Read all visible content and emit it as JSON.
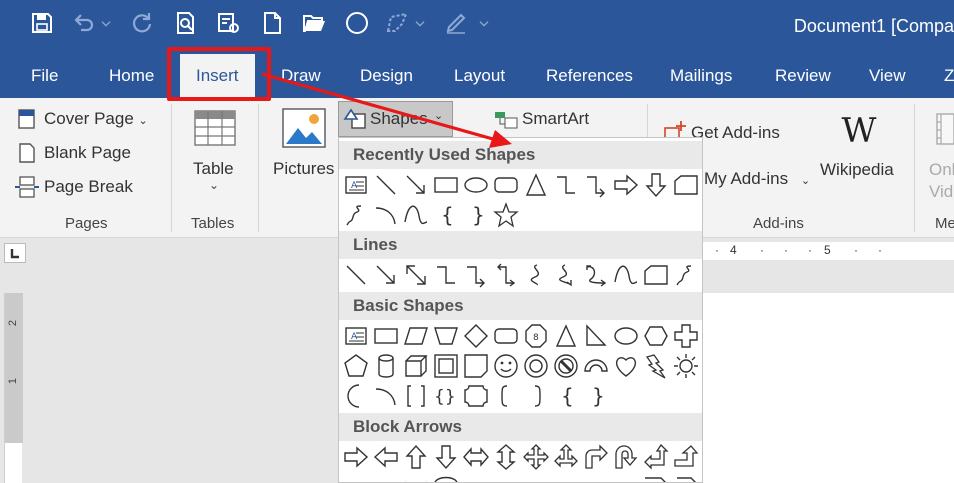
{
  "window": {
    "title": "Document1 [Compa"
  },
  "tabs": [
    "File",
    "Home",
    "Insert",
    "Draw",
    "Design",
    "Layout",
    "References",
    "Mailings",
    "Review",
    "View",
    "Z"
  ],
  "active_tab": "Insert",
  "ribbon": {
    "pages": {
      "cover_page": "Cover Page",
      "blank_page": "Blank Page",
      "page_break": "Page Break",
      "group_label": "Pages"
    },
    "tables": {
      "table": "Table",
      "group_label": "Tables"
    },
    "illustrations": {
      "pictures": "Pictures",
      "shapes": "Shapes",
      "smartart": "SmartArt"
    },
    "addins": {
      "get_addins": "Get Add-ins",
      "my_addins": "My Add-ins",
      "wikipedia": "Wikipedia",
      "group_label": "Add-ins"
    },
    "media": {
      "online_video_1": "Onl",
      "online_video_2": "Vid",
      "group_label": "Me"
    }
  },
  "shapes_menu": {
    "sections": {
      "recent": "Recently Used Shapes",
      "lines": "Lines",
      "basic": "Basic Shapes",
      "block_arrows": "Block Arrows"
    }
  },
  "ruler": {
    "top": [
      "4",
      "5"
    ],
    "left": [
      "2",
      "1"
    ]
  },
  "colors": {
    "ribbon_blue": "#2b579a",
    "highlight_red": "#e81818"
  }
}
